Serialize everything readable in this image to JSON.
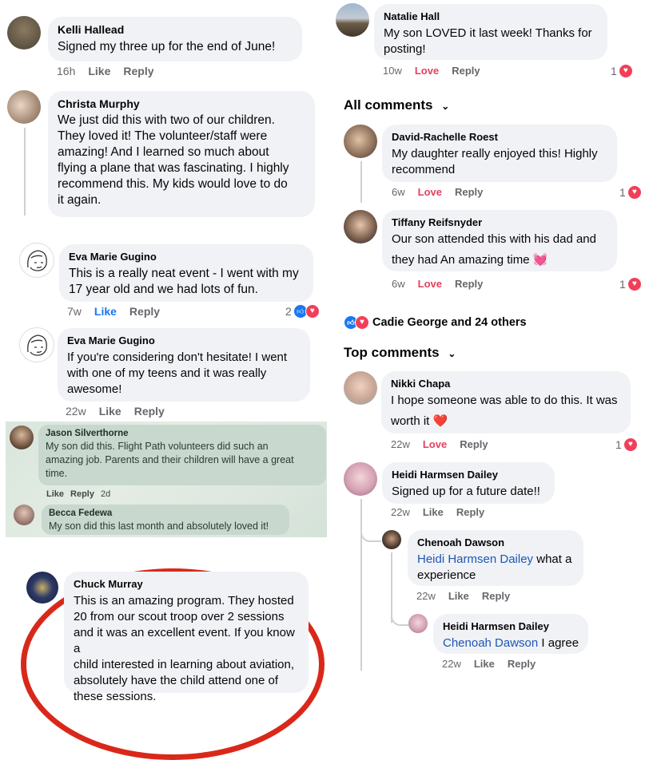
{
  "left": {
    "c1": {
      "name": "Kelli Hallead",
      "text": "Signed my three up for the end of June!",
      "time": "16h",
      "like": "Like",
      "reply": "Reply"
    },
    "c2": {
      "name": "Christa Murphy",
      "lines": [
        "We just did this with two of our children.",
        "They loved it! The volunteer/staff were",
        "amazing! And I learned so much about",
        "flying a plane that was fascinating. I highly",
        "recommend this. My kids would love to do",
        "it again."
      ]
    },
    "c3": {
      "name": "Eva Marie Gugino",
      "lines": [
        "This is a really neat event - I went with my",
        "17 year old and we had lots of fun."
      ],
      "time": "7w",
      "like": "Like",
      "reply": "Reply",
      "count": "2"
    },
    "c4": {
      "name": "Eva Marie Gugino",
      "lines": [
        "If you're considering don't hesitate!  I went",
        "with one of my teens and it was really",
        "awesome!"
      ],
      "time": "22w",
      "like": "Like",
      "reply": "Reply"
    },
    "c5": {
      "name": "Jason Silverthorne",
      "lines": [
        "My son did this. Flight Path volunteers did such an",
        "amazing job. Parents and their children will have a great",
        "time."
      ],
      "like": "Like",
      "reply": "Reply",
      "time": "2d"
    },
    "c6": {
      "name": "Becca Fedewa",
      "text": "My son did this last month and absolutely loved it!"
    },
    "c7": {
      "name": "Chuck Murray",
      "lines": [
        "This is an amazing program. They hosted",
        "20 from our scout troop over 2 sessions",
        "and it was an excellent event. If you know a",
        "child interested in learning about aviation,",
        "absolutely have the child attend one of",
        "these sessions."
      ]
    }
  },
  "right": {
    "c1": {
      "name": "Natalie Hall",
      "lines": [
        "My son LOVED it last week! Thanks for",
        "posting!"
      ],
      "time": "10w",
      "love": "Love",
      "reply": "Reply",
      "count": "1"
    },
    "all_comments": "All comments",
    "c2": {
      "name": "David-Rachelle Roest",
      "lines": [
        "My daughter really enjoyed this! Highly",
        "recommend"
      ],
      "time": "6w",
      "love": "Love",
      "reply": "Reply",
      "count": "1"
    },
    "c3": {
      "name": "Tiffany Reifsnyder",
      "lines": [
        "Our son attended this with his dad and",
        "they had An amazing time 💓"
      ],
      "time": "6w",
      "love": "Love",
      "reply": "Reply",
      "count": "1"
    },
    "reactions_summary": "Cadie George and 24 others",
    "top_comments": "Top comments",
    "c4": {
      "name": "Nikki Chapa",
      "lines": [
        "I hope someone was able to do this. It was",
        "worth it ❤️"
      ],
      "time": "22w",
      "love": "Love",
      "reply": "Reply",
      "count": "1"
    },
    "c5": {
      "name": "Heidi Harmsen Dailey",
      "text": "Signed up for a future date!!",
      "time": "22w",
      "like": "Like",
      "reply": "Reply"
    },
    "c6": {
      "name": "Chenoah Dawson",
      "mention": "Heidi Harmsen Dailey",
      "rest": " what a",
      "line2": "experience",
      "time": "22w",
      "like": "Like",
      "reply": "Reply"
    },
    "c7": {
      "name": "Heidi Harmsen Dailey",
      "mention": "Chenoah Dawson",
      "rest": " I agree",
      "time": "22w",
      "like": "Like",
      "reply": "Reply"
    }
  },
  "colors": {
    "love": "#e4405f",
    "like_blue": "#1877f2",
    "bubble": "#f0f2f5",
    "red_circle": "#d9281a"
  },
  "icons": [
    "heart-reaction-icon",
    "like-reaction-icon",
    "chevron-down-icon"
  ]
}
